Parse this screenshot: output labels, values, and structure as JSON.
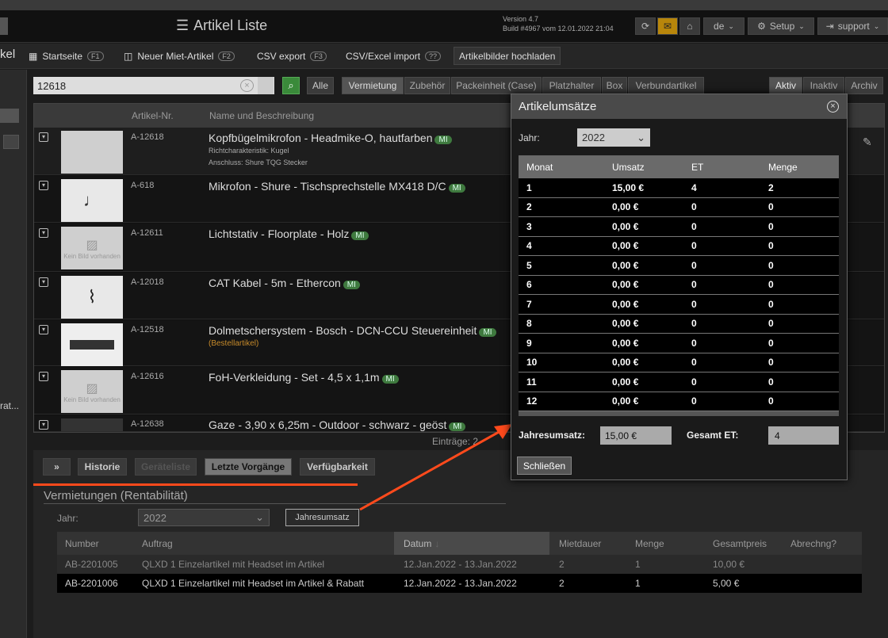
{
  "header": {
    "title": "Artikel Liste",
    "version": "Version 4.7",
    "build": "Build #4967 vom 12.01.2022 21:04",
    "lang": "de",
    "setup": "Setup",
    "support": "support"
  },
  "toolbar": {
    "left_cut": "kel",
    "startseite": "Startseite",
    "startseite_key": "F1",
    "neuer": "Neuer Miet-Artikel",
    "neuer_key": "F2",
    "csv": "CSV export",
    "csv_key": "F3",
    "excel": "CSV/Excel import",
    "excel_key": "??",
    "bilder": "Artikelbilder hochladen"
  },
  "search": {
    "value": "12618"
  },
  "filters": [
    "Alle",
    "Vermietung",
    "Zubehör",
    "Packeinheit (Case)",
    "Platzhalter",
    "Box",
    "Verbundartikel"
  ],
  "status_filters": [
    "Aktiv",
    "Inaktiv",
    "Archiv"
  ],
  "grid": {
    "col_artno": "Artikel-Nr.",
    "col_name": "Name und Beschreibung",
    "entries": "Einträge: 2"
  },
  "no_image": "Kein Bild vorhanden",
  "rows": [
    {
      "artno": "A-12618",
      "name": "Kopfbügelmikrofon - Headmike-O, hautfarben",
      "badge": "MI",
      "sub1": "Richtcharakteristik: Kugel",
      "sub2": "Anschluss: Shure TQG Stecker"
    },
    {
      "artno": "A-618",
      "name": "Mikrofon - Shure - Tischsprechstelle MX418 D/C",
      "badge": "MI"
    },
    {
      "artno": "A-12611",
      "name": "Lichtstativ - Floorplate - Holz",
      "badge": "MI"
    },
    {
      "artno": "A-12018",
      "name": "CAT Kabel - 5m - Ethercon",
      "badge": "MI"
    },
    {
      "artno": "A-12518",
      "name": "Dolmetschersystem - Bosch - DCN-CCU Steuereinheit",
      "badge": "MI",
      "sub1": "(Bestellartikel)"
    },
    {
      "artno": "A-12616",
      "name": "FoH-Verkleidung - Set - 4,5 x 1,1m",
      "badge": "MI"
    },
    {
      "artno": "A-12638",
      "name": "Gaze - 3,90 x 6,25m - Outdoor - schwarz - geöst",
      "badge": "MI"
    }
  ],
  "sidebar": {
    "cut_text": "rat..."
  },
  "dialog": {
    "title": "Artikelumsätze",
    "year_label": "Jahr:",
    "year": "2022",
    "headers": [
      "Monat",
      "Umsatz",
      "ET",
      "Menge"
    ],
    "months": [
      [
        "1",
        "15,00 €",
        "4",
        "2"
      ],
      [
        "2",
        "0,00 €",
        "0",
        "0"
      ],
      [
        "3",
        "0,00 €",
        "0",
        "0"
      ],
      [
        "4",
        "0,00 €",
        "0",
        "0"
      ],
      [
        "5",
        "0,00 €",
        "0",
        "0"
      ],
      [
        "6",
        "0,00 €",
        "0",
        "0"
      ],
      [
        "7",
        "0,00 €",
        "0",
        "0"
      ],
      [
        "8",
        "0,00 €",
        "0",
        "0"
      ],
      [
        "9",
        "0,00 €",
        "0",
        "0"
      ],
      [
        "10",
        "0,00 €",
        "0",
        "0"
      ],
      [
        "11",
        "0,00 €",
        "0",
        "0"
      ],
      [
        "12",
        "0,00 €",
        "0",
        "0"
      ]
    ],
    "jahresumsatz_label": "Jahresumsatz:",
    "jahresumsatz": "15,00 €",
    "gesamt_et_label": "Gesamt ET:",
    "gesamt_et": "4",
    "close": "Schließen"
  },
  "bottom": {
    "tabs": [
      "Historie",
      "Geräteliste",
      "Letzte Vorgänge",
      "Verfügbarkeit"
    ],
    "section_title": "Vermietungen (Rentabilität)",
    "year_label": "Jahr:",
    "year": "2022",
    "jahresumsatz_btn": "Jahresumsatz",
    "headers": [
      "Number",
      "Auftrag",
      "Datum",
      "Mietdauer",
      "Menge",
      "Gesamtpreis",
      "Abrechng?"
    ],
    "rows": [
      [
        "AB-2201005",
        "QLXD 1 Einzelartikel mit Headset im Artikel",
        "12.Jan.2022 - 13.Jan.2022",
        "2",
        "1",
        "10,00 €",
        ""
      ],
      [
        "AB-2201006",
        "QLXD 1 Einzelartikel mit Headset im Artikel & Rabatt",
        "12.Jan.2022 - 13.Jan.2022",
        "2",
        "1",
        "5,00 €",
        ""
      ]
    ]
  },
  "colors": {
    "accent_red": "#ff4a1c",
    "badge_green": "#3f7a3f",
    "search_green": "#3a8a3a"
  }
}
